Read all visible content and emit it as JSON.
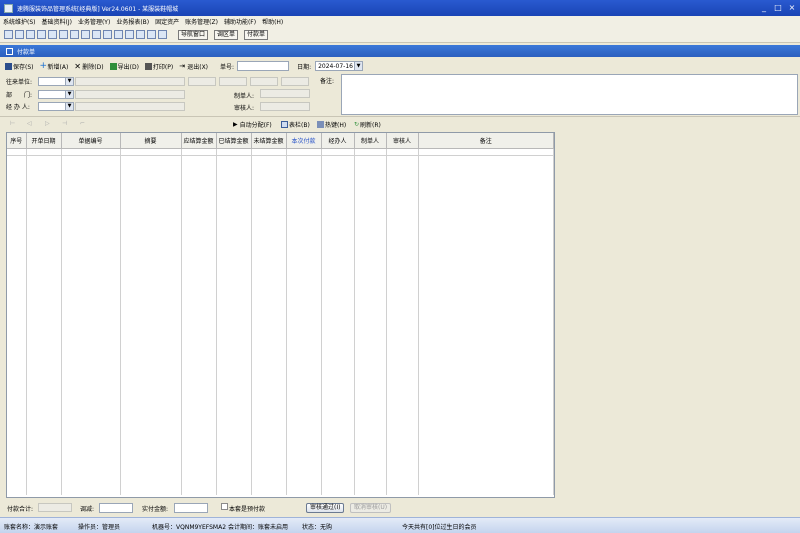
{
  "window": {
    "title": "速腾服装饰品管理系统[经典版] Ver24.0601 - 某服装鞋帽城",
    "controls": [
      "_",
      "□",
      "×"
    ]
  },
  "menu": [
    "系统维护(S)",
    "基础资料(J)",
    "业务管理(Y)",
    "业务报表(B)",
    "固定资产",
    "账务管理(Z)",
    "辅助功能(F)",
    "帮助(H)"
  ],
  "toolbar_top": {
    "buttons": [
      "导航窗口",
      "调区单",
      "付款单"
    ]
  },
  "panel": {
    "title": "付款单"
  },
  "actions": {
    "save": "保存(S)",
    "add": "新增(A)",
    "delete": "删除(D)",
    "export": "导出(D)",
    "print": "打印(P)",
    "exit": "退出(X)",
    "doc_no_label": "单号:",
    "doc_no_value": "",
    "date_label": "日期:",
    "date_value": "2024-07-16"
  },
  "form": {
    "partner_label": "往来单位:",
    "dept_label": "部　　门:",
    "handler_label": "经 办 人:",
    "maker_label": "制单人:",
    "auditor_label": "审核人:",
    "remark_label": "备注:"
  },
  "actions2": {
    "auto_alloc": "自动分配(F)",
    "columns": "表栏(B)",
    "hotkey": "热键(H)",
    "refresh": "刷新(R)"
  },
  "grid": {
    "columns": [
      "序号",
      "开单日期",
      "单据编号",
      "摘要",
      "应结算金额",
      "已结算金额",
      "未结算金额",
      "本次付款",
      "经办人",
      "制单人",
      "审核人",
      "备注"
    ],
    "rows": []
  },
  "footer": {
    "total_label": "付款合计:",
    "adjust_label": "调减:",
    "actual_label": "实付金额:",
    "prepay_label": "本套是预付款",
    "approve": "审核通过(I)",
    "cancel_approve": "取消审核(U)"
  },
  "status": {
    "account": "账套名称：演示账套",
    "operator": "操作员：管理员",
    "machine": "机器号：VQNM9YEFSMA2",
    "period": "会计期间：账套未启用",
    "state": "状态：无购",
    "birthday": "今天共有[0]位过生日的会员"
  },
  "colors": {
    "title_bar": "#1a44b5",
    "panel_header": "#2b5fbf",
    "accent_text": "#2450c8"
  }
}
